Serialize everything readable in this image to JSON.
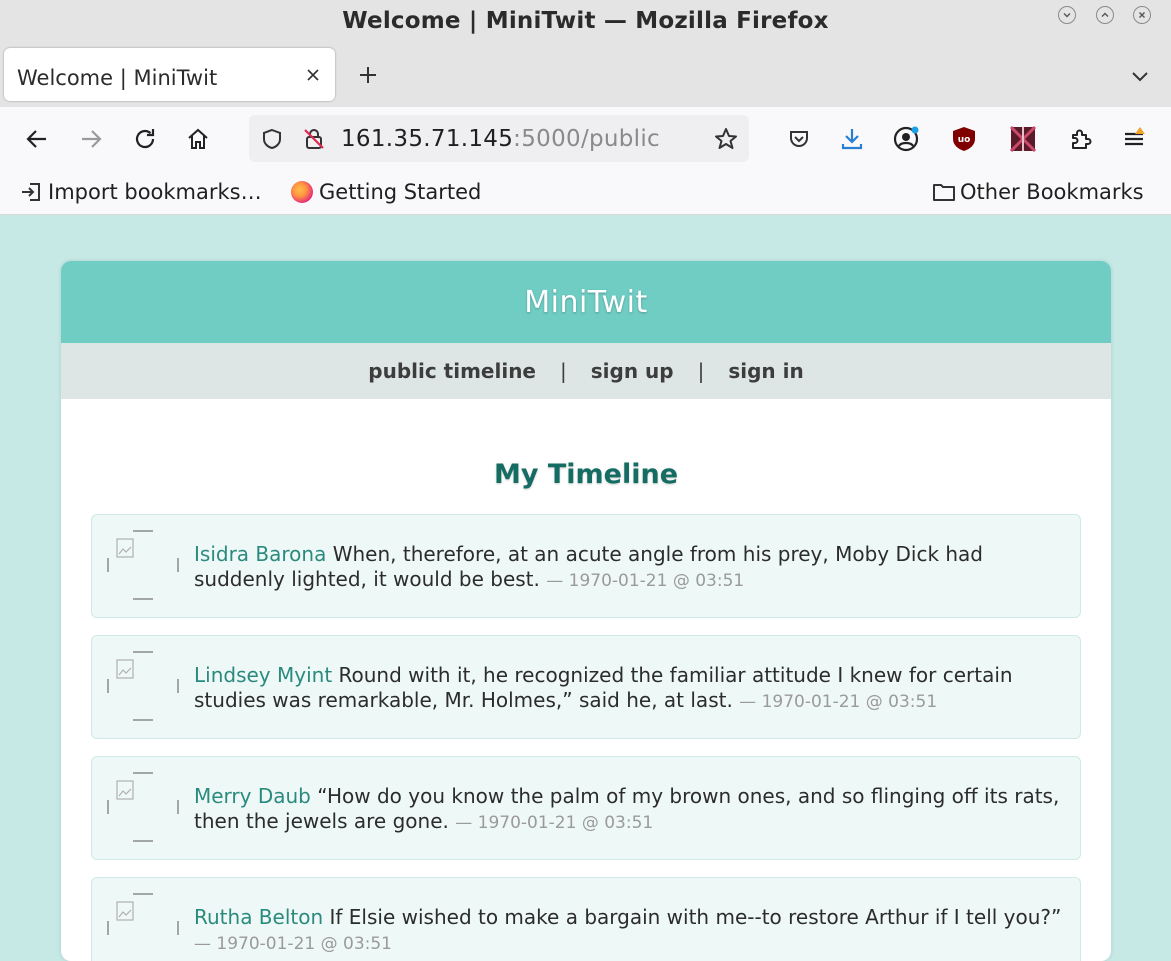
{
  "window": {
    "title": "Welcome | MiniTwit — Mozilla Firefox"
  },
  "tab": {
    "title": "Welcome | MiniTwit"
  },
  "address": {
    "host": "161.35.71.145",
    "rest": ":5000/public"
  },
  "bookmarks": {
    "import": "Import bookmarks…",
    "getting_started": "Getting Started",
    "other": "Other Bookmarks"
  },
  "site": {
    "title": "MiniTwit",
    "nav": {
      "public_timeline": "public timeline",
      "sep": "|",
      "sign_up": "sign up",
      "sign_in": "sign in"
    },
    "heading": "My Timeline"
  },
  "messages": [
    {
      "user": "Isidra Barona",
      "text": "When, therefore, at an acute angle from his prey, Moby Dick had suddenly lighted, it would be best.",
      "date": "— 1970-01-21 @ 03:51"
    },
    {
      "user": "Lindsey Myint",
      "text": "Round with it, he recognized the familiar attitude I knew for certain studies was remarkable, Mr. Holmes,” said he, at last.",
      "date": "— 1970-01-21 @ 03:51"
    },
    {
      "user": "Merry Daub",
      "text": "“How do you know the palm of my brown ones, and so flinging off its rats, then the jewels are gone.",
      "date": "— 1970-01-21 @ 03:51"
    },
    {
      "user": "Rutha Belton",
      "text": "If Elsie wished to make a bargain with me--to restore Arthur if I tell you?”",
      "date": "— 1970-01-21 @ 03:51"
    }
  ]
}
